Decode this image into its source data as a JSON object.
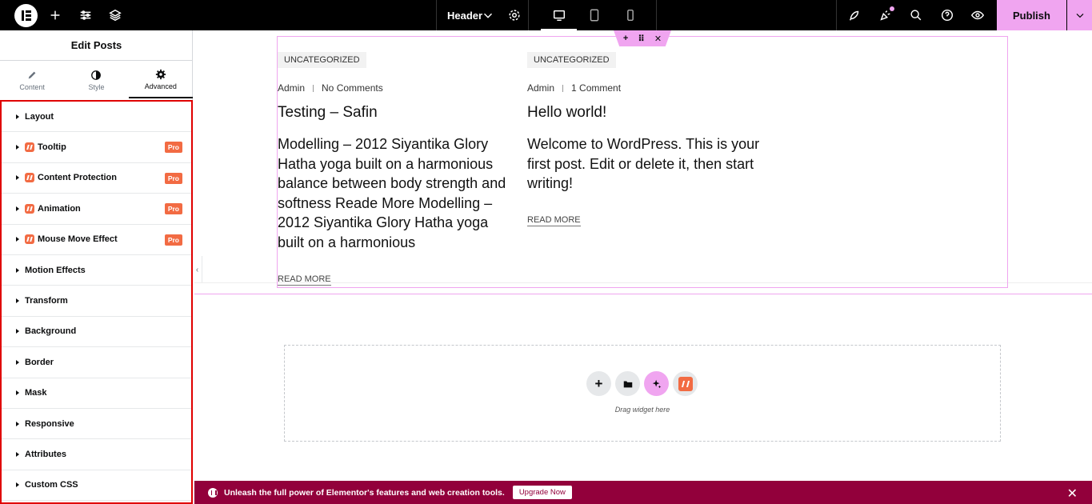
{
  "topbar": {
    "document_name": "Header",
    "publish_label": "Publish",
    "accent_color": "#f0a5f0"
  },
  "sidebar": {
    "title": "Edit Posts",
    "tabs": [
      {
        "label": "Content",
        "icon": "pencil-icon"
      },
      {
        "label": "Style",
        "icon": "half-circle-icon"
      },
      {
        "label": "Advanced",
        "icon": "gear-icon",
        "active": true
      }
    ],
    "sections": [
      {
        "label": "Layout",
        "pro": false
      },
      {
        "label": "Tooltip",
        "pro": true
      },
      {
        "label": "Content Protection",
        "pro": true
      },
      {
        "label": "Animation",
        "pro": true
      },
      {
        "label": "Mouse Move Effect",
        "pro": true
      },
      {
        "label": "Motion Effects",
        "pro": false
      },
      {
        "label": "Transform",
        "pro": false
      },
      {
        "label": "Background",
        "pro": false
      },
      {
        "label": "Border",
        "pro": false
      },
      {
        "label": "Mask",
        "pro": false
      },
      {
        "label": "Responsive",
        "pro": false
      },
      {
        "label": "Attributes",
        "pro": false
      },
      {
        "label": "Custom CSS",
        "pro": false
      }
    ],
    "pro_badge": "Pro"
  },
  "posts": [
    {
      "category": "UNCATEGORIZED",
      "author": "Admin",
      "comments": "No Comments",
      "title": "Testing – Safin",
      "excerpt": "Modelling – 2012 Siyantika Glory Hatha yoga built on a harmonious balance between body strength and softness Reade More Modelling – 2012 Siyantika Glory Hatha yoga built on a harmonious",
      "read_more": "READ MORE"
    },
    {
      "category": "UNCATEGORIZED",
      "author": "Admin",
      "comments": "1 Comment",
      "title": "Hello world!",
      "excerpt": "Welcome to WordPress. This is your first post. Edit or delete it, then start writing!",
      "read_more": "READ MORE"
    }
  ],
  "dropzone": {
    "text": "Drag widget here"
  },
  "banner": {
    "text": "Unleash the full power of Elementor's features and web creation tools.",
    "upgrade_label": "Upgrade Now",
    "color": "#92003b"
  }
}
